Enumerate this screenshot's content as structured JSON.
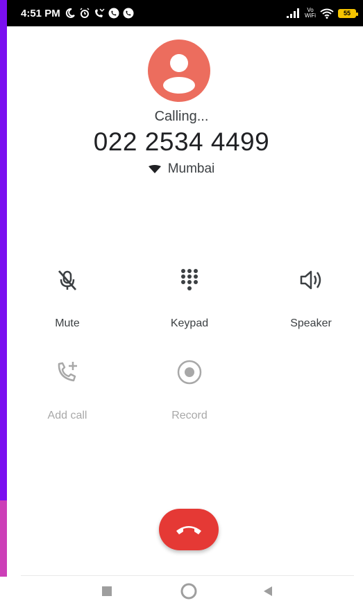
{
  "status_bar": {
    "time": "4:51 PM",
    "vowifi_top": "Vo",
    "vowifi_bottom": "WiFi",
    "battery_level": "55"
  },
  "call": {
    "status": "Calling...",
    "number": "022 2534 4499",
    "location": "Mumbai"
  },
  "controls": {
    "mute": "Mute",
    "keypad": "Keypad",
    "speaker": "Speaker",
    "add_call": "Add call",
    "record": "Record"
  },
  "colors": {
    "avatar": "#ec6d5e",
    "end_call": "#e53935",
    "edge_purple": "#7a0ff0",
    "edge_pink": "#cc3fb7"
  },
  "icons": {
    "mute": "mic-off-icon",
    "keypad": "dialpad-icon",
    "speaker": "volume-icon",
    "add_call": "add-call-icon",
    "record": "record-icon",
    "end_call": "call-end-icon",
    "nav_recents": "square-icon",
    "nav_home": "circle-icon",
    "nav_back": "triangle-back-icon"
  }
}
